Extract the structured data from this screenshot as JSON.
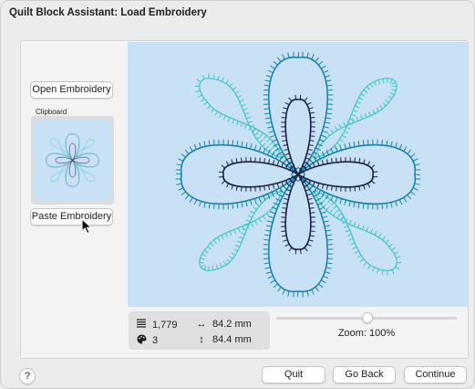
{
  "window": {
    "title": "Quilt Block Assistant: Load Embroidery"
  },
  "left": {
    "open_label": "Open Embroidery",
    "clipboard_label": "Clipboard",
    "paste_label": "Paste Embroidery"
  },
  "info": {
    "stitches": "1,779",
    "colors": "3",
    "width": "84.2 mm",
    "height": "84.4 mm"
  },
  "zoom": {
    "label": "Zoom: 100%",
    "value_percent": 100
  },
  "footer": {
    "help_label": "?",
    "quit_label": "Quit",
    "back_label": "Go Back",
    "continue_label": "Continue"
  },
  "colors": {
    "canvas_bg": "#c8e1f5",
    "thread_navy": "#1a2146",
    "thread_blue": "#1884ad",
    "thread_teal": "#3ec7c6"
  },
  "icons": [
    "stitch-count-icon",
    "palette-icon",
    "width-arrow-icon",
    "height-arrow-icon",
    "mouse-cursor-icon",
    "help-icon"
  ]
}
